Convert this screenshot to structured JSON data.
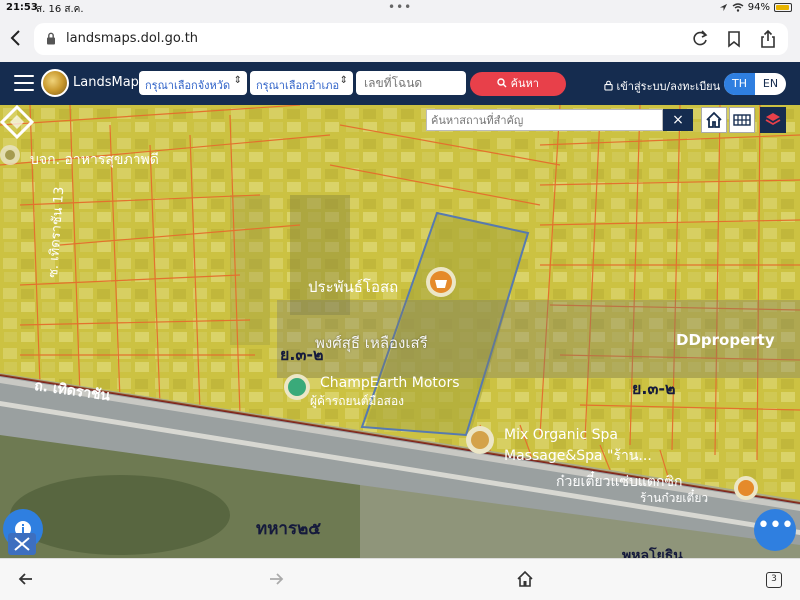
{
  "status_bar": {
    "time": "21:53",
    "date": "ส. 16 ส.ค.",
    "battery": "94%",
    "battery_level": 0.94
  },
  "browser": {
    "url": "landsmaps.dol.go.th"
  },
  "navbar": {
    "brand": "LandsMaps",
    "province_select": "กรุณาเลือกจังหวัด",
    "district_select": "กรุณาเลือกอำเภอ",
    "deed_placeholder": "เลขที่โฉนด",
    "search_label": "ค้นหา",
    "login_label": "เข้าสู่ระบบ/ลงทะเบียน",
    "lang_th": "TH",
    "lang_en": "EN",
    "active_lang": "TH"
  },
  "map": {
    "place_search_placeholder": "ค้นหาสถานที่สำคัญ",
    "clear_symbol": "×",
    "labels": {
      "poi_top_left": "บจก. อาหารสุขภาพดี",
      "street_side": "ซ. เทิดราชัน 13",
      "poi_center": "ประพันธ์โอสถ",
      "zone_left": "ย.๓-๒",
      "zone_right": "ย.๓-๒",
      "poi_motors": "ChampEarth Motors",
      "poi_motors_sub": "ผู้ค้ารถยนต์มือสอง",
      "main_road": "ถ. เทิดราชัน",
      "poi_spa": "Mix Organic Spa",
      "poi_spa_sub": "Massage&Spa \"ร้าน...",
      "poi_noodle": "ก๋วยเตี๋ยวแซ่บแตกซิก",
      "poi_noodle_sub": "ร้านก๋วยเตี๋ยว",
      "area_label": "ทหาร๒๕",
      "bottom_partial": "พหลโยธิน"
    },
    "watermark": {
      "name": "พงศ์สุธี เหลืองเสรี",
      "brand": "DDproperty"
    },
    "fab_more": "•••"
  },
  "bottom_bar": {
    "tab_count": "3"
  },
  "colors": {
    "navbar_bg": "#152c4f",
    "search_btn": "#e8404a",
    "accent_blue": "#2f7fe0",
    "parcel_line": "#e2542a",
    "selected_parcel": "#2f5fd0",
    "overlay_yellow": "#d9d23a"
  },
  "icons": {
    "back": "chevron-left-icon",
    "lock": "lock-icon",
    "reload": "reload-icon",
    "bookmark": "bookmark-icon",
    "share": "share-icon",
    "menu": "hamburger-icon",
    "home": "home-icon",
    "grid": "grid-icon",
    "layers": "layers-icon",
    "info": "info-icon",
    "ruler": "ruler-icon",
    "more": "more-dots-icon"
  }
}
